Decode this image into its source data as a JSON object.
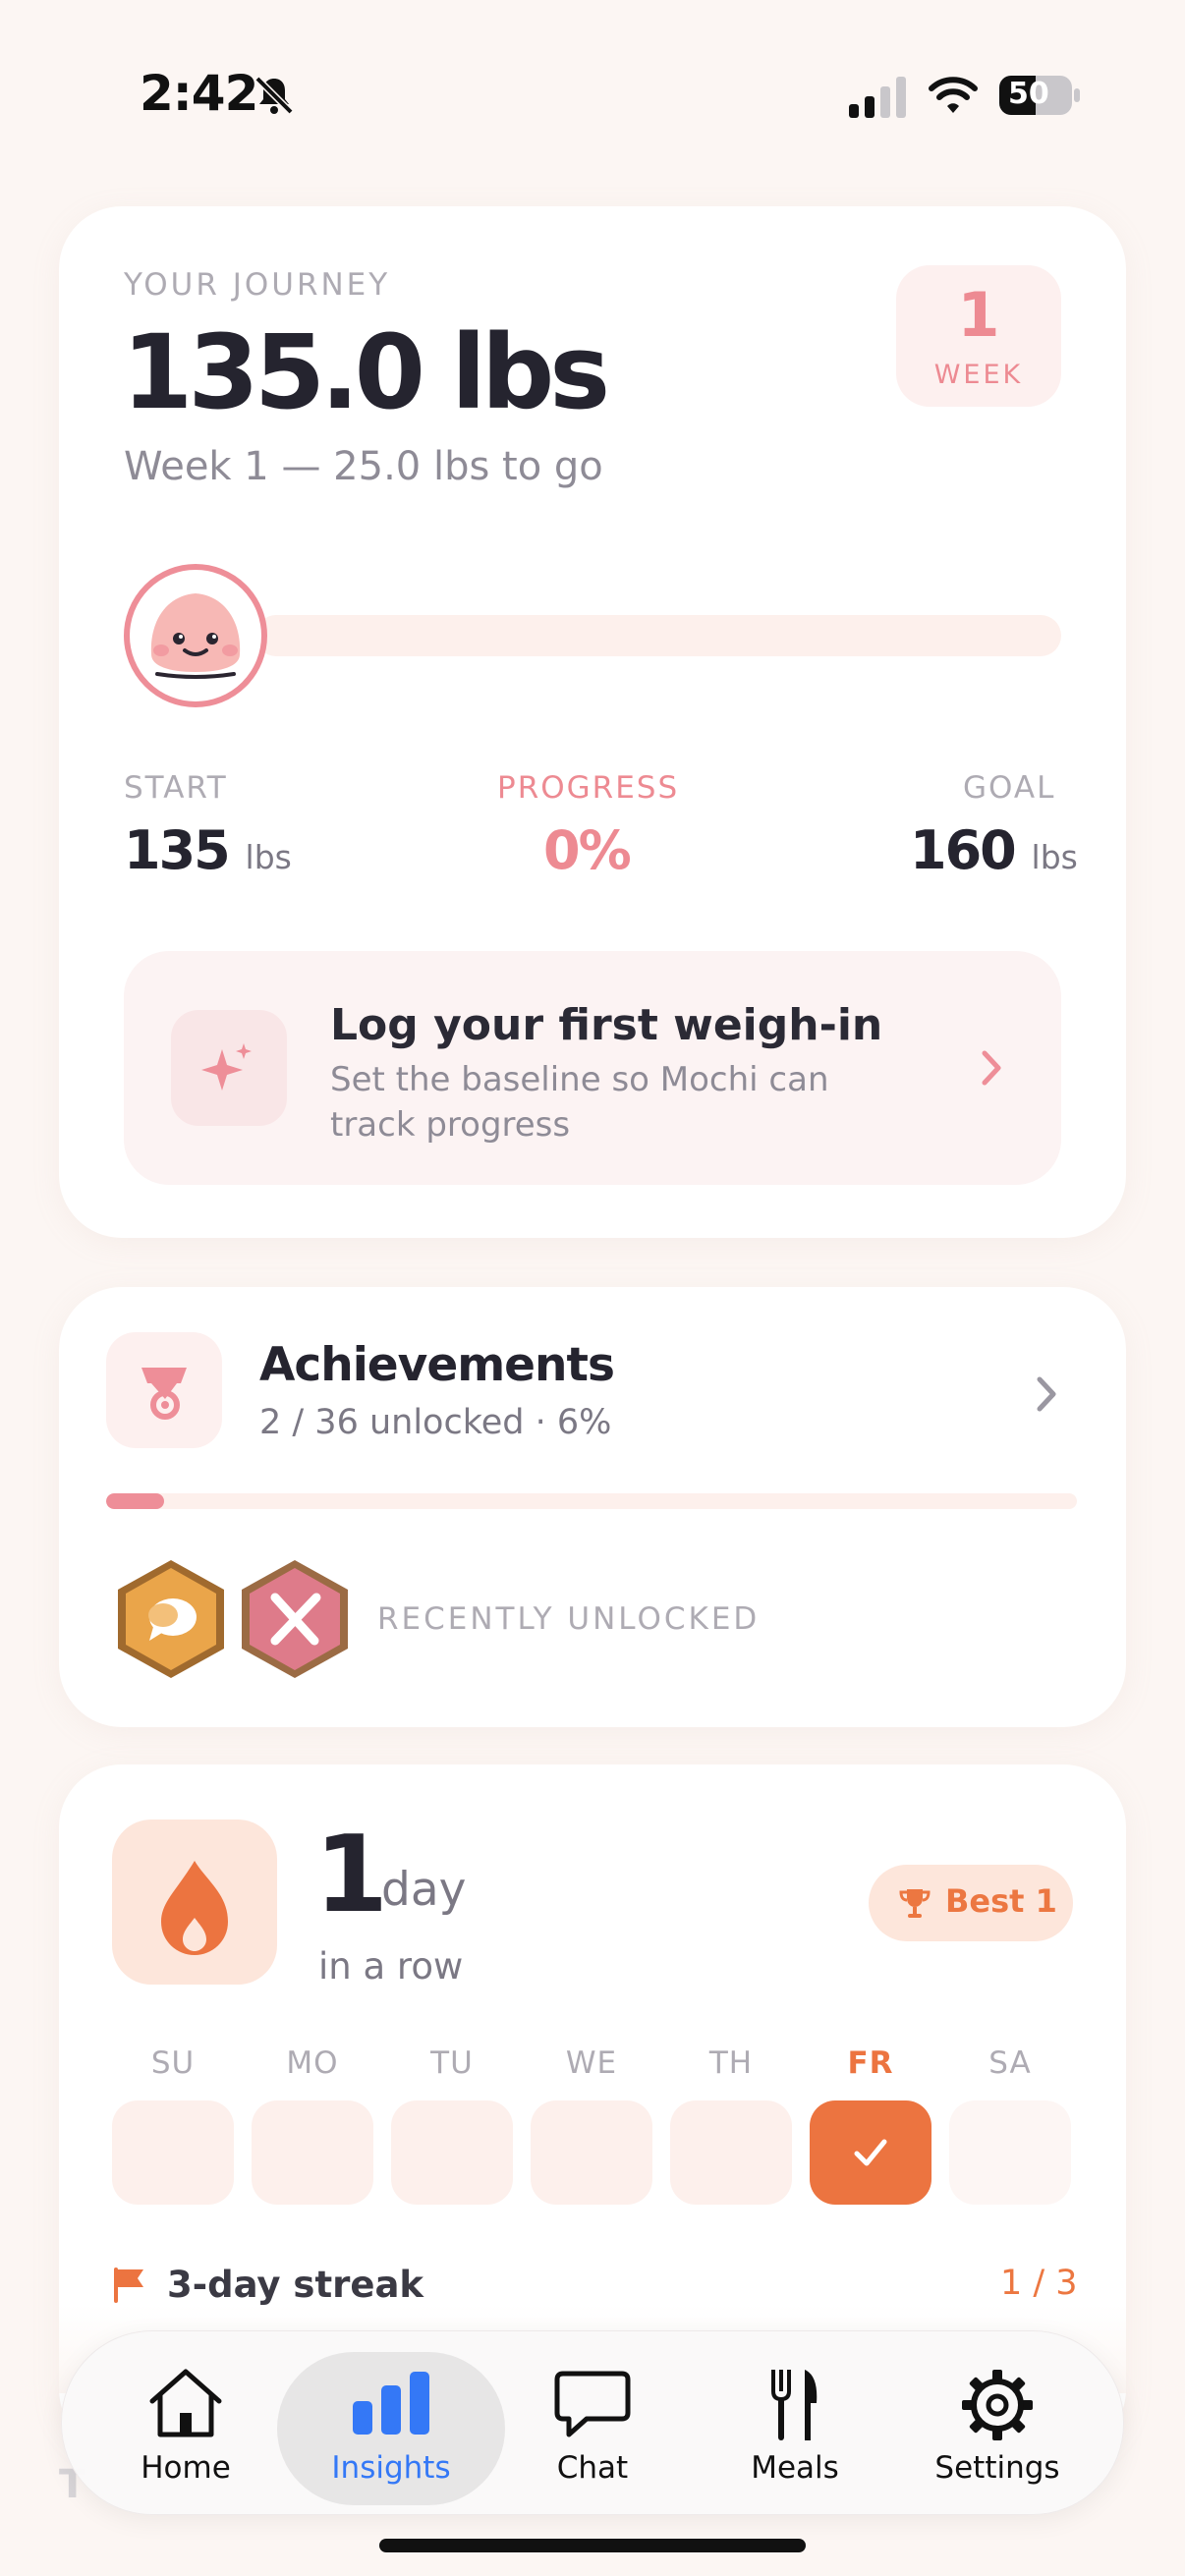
{
  "status_bar": {
    "time": "2:42",
    "battery": "50"
  },
  "journey": {
    "label": "YOUR JOURNEY",
    "weight": "135.0 lbs",
    "subtitle": "Week 1 — 25.0 lbs to go",
    "week_number": "1",
    "week_label": "WEEK",
    "progress_fraction": 0,
    "start_label": "START",
    "start_value": "135",
    "start_unit": "lbs",
    "progress_label": "PROGRESS",
    "progress_value": "0%",
    "goal_label": "GOAL",
    "goal_value": "160",
    "goal_unit": "lbs",
    "cta_title": "Log your first weigh-in",
    "cta_desc": "Set the baseline so Mochi can track progress"
  },
  "achievements": {
    "title": "Achievements",
    "subtitle": "2 / 36 unlocked · 6%",
    "progress_fraction": 0.06,
    "recent_label": "RECENTLY UNLOCKED",
    "badges": [
      "chat-badge-icon",
      "meals-badge-icon"
    ]
  },
  "streak": {
    "count": "1",
    "unit": "day",
    "row_label": "in a row",
    "best_label": "Best 1",
    "days": [
      {
        "label": "SU",
        "state": "missed"
      },
      {
        "label": "MO",
        "state": "missed"
      },
      {
        "label": "TU",
        "state": "missed"
      },
      {
        "label": "WE",
        "state": "missed"
      },
      {
        "label": "TH",
        "state": "missed"
      },
      {
        "label": "FR",
        "state": "done"
      },
      {
        "label": "SA",
        "state": "future"
      }
    ],
    "goal_label": "3-day streak",
    "goal_value": "1 / 3",
    "accent": "#ec7440"
  },
  "tabbar": {
    "tabs": [
      {
        "label": "Home",
        "icon": "home-icon",
        "active": false
      },
      {
        "label": "Insights",
        "icon": "bar-chart-icon",
        "active": true
      },
      {
        "label": "Chat",
        "icon": "chat-bubble-icon",
        "active": false
      },
      {
        "label": "Meals",
        "icon": "fork-knife-icon",
        "active": false
      },
      {
        "label": "Settings",
        "icon": "gear-icon",
        "active": false
      }
    ],
    "active_color": "#3478f6"
  }
}
